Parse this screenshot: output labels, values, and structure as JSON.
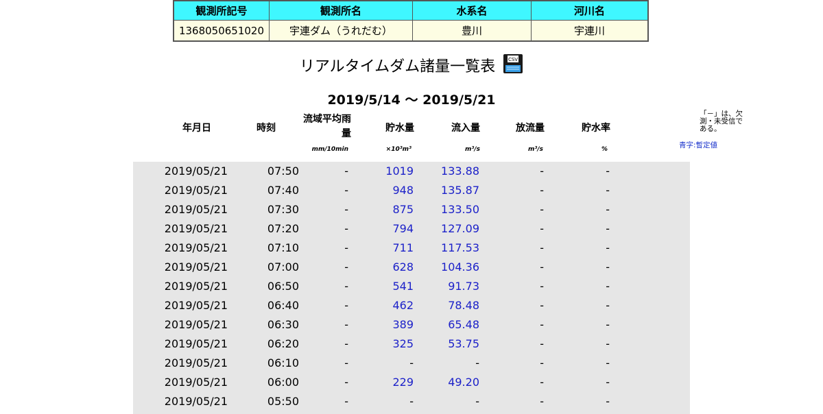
{
  "station": {
    "headers": [
      "観測所記号",
      "観測所名",
      "水系名",
      "河川名"
    ],
    "values": [
      "1368050651020",
      "宇連ダム（うれだむ）",
      "豊川",
      "宇連川"
    ]
  },
  "title": "リアルタイムダム諸量一覧表",
  "period": "2019/5/14 ～ 2019/5/21",
  "columns": {
    "date": "年月日",
    "time": "時刻",
    "rain_line1": "流域平均雨",
    "rain_line2": "量",
    "storage": "貯水量",
    "inflow": "流入量",
    "outflow": "放流量",
    "rate": "貯水率"
  },
  "units": {
    "rain": "mm/10min",
    "storage": "×10³m³",
    "inflow": "m³/s",
    "outflow": "m³/s",
    "rate": "%"
  },
  "note": "「－」は、欠測・未受信である。",
  "legend": "青字:暫定値",
  "icons": {
    "save": "floppy-disk-icon"
  },
  "colors": {
    "header_bg": "#3ff7ff",
    "value_bg": "#fdfde3",
    "data_bg": "#e6e6e6",
    "provisional": "#1c21c9"
  },
  "rows": [
    {
      "date": "2019/05/21",
      "time": "07:50",
      "rain": "-",
      "storage": "1019",
      "inflow": "133.88",
      "outflow": "-",
      "rate": "-"
    },
    {
      "date": "2019/05/21",
      "time": "07:40",
      "rain": "-",
      "storage": "948",
      "inflow": "135.87",
      "outflow": "-",
      "rate": "-"
    },
    {
      "date": "2019/05/21",
      "time": "07:30",
      "rain": "-",
      "storage": "875",
      "inflow": "133.50",
      "outflow": "-",
      "rate": "-"
    },
    {
      "date": "2019/05/21",
      "time": "07:20",
      "rain": "-",
      "storage": "794",
      "inflow": "127.09",
      "outflow": "-",
      "rate": "-"
    },
    {
      "date": "2019/05/21",
      "time": "07:10",
      "rain": "-",
      "storage": "711",
      "inflow": "117.53",
      "outflow": "-",
      "rate": "-"
    },
    {
      "date": "2019/05/21",
      "time": "07:00",
      "rain": "-",
      "storage": "628",
      "inflow": "104.36",
      "outflow": "-",
      "rate": "-"
    },
    {
      "date": "2019/05/21",
      "time": "06:50",
      "rain": "-",
      "storage": "541",
      "inflow": "91.73",
      "outflow": "-",
      "rate": "-"
    },
    {
      "date": "2019/05/21",
      "time": "06:40",
      "rain": "-",
      "storage": "462",
      "inflow": "78.48",
      "outflow": "-",
      "rate": "-"
    },
    {
      "date": "2019/05/21",
      "time": "06:30",
      "rain": "-",
      "storage": "389",
      "inflow": "65.48",
      "outflow": "-",
      "rate": "-"
    },
    {
      "date": "2019/05/21",
      "time": "06:20",
      "rain": "-",
      "storage": "325",
      "inflow": "53.75",
      "outflow": "-",
      "rate": "-"
    },
    {
      "date": "2019/05/21",
      "time": "06:10",
      "rain": "-",
      "storage": "-",
      "inflow": "-",
      "outflow": "-",
      "rate": "-"
    },
    {
      "date": "2019/05/21",
      "time": "06:00",
      "rain": "-",
      "storage": "229",
      "inflow": "49.20",
      "outflow": "-",
      "rate": "-"
    },
    {
      "date": "2019/05/21",
      "time": "05:50",
      "rain": "-",
      "storage": "-",
      "inflow": "-",
      "outflow": "-",
      "rate": "-"
    }
  ]
}
